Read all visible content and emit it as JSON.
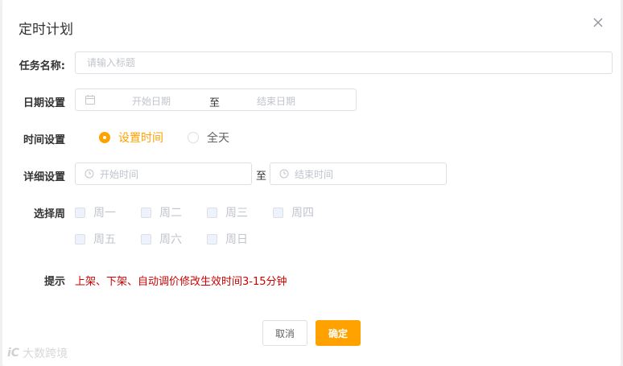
{
  "dialog": {
    "title": "定时计划",
    "close_icon": "close-icon"
  },
  "form": {
    "task_name": {
      "label": "任务名称:",
      "placeholder": "请输入标题",
      "value": ""
    },
    "date": {
      "label": "日期设置",
      "start_placeholder": "开始日期",
      "separator": "至",
      "end_placeholder": "结束日期",
      "icon": "calendar-icon"
    },
    "time_mode": {
      "label": "时间设置",
      "options": [
        {
          "label": "设置时间",
          "selected": true
        },
        {
          "label": "全天",
          "selected": false
        }
      ]
    },
    "detail_time": {
      "label": "详细设置",
      "start_placeholder": "开始时间",
      "separator": "至",
      "end_placeholder": "结束时间",
      "icon": "clock-icon"
    },
    "weekdays": {
      "label": "选择周",
      "days": [
        "周一",
        "周二",
        "周三",
        "周四",
        "周五",
        "周六",
        "周日"
      ]
    },
    "tip": {
      "label": "提示",
      "text": "上架、下架、自动调价修改生效时间3-15分钟"
    }
  },
  "buttons": {
    "cancel": "取消",
    "confirm": "确定"
  },
  "watermark": {
    "logo": "iC",
    "text": "大数跨境"
  },
  "colors": {
    "accent": "#ffa200",
    "tip": "#d00000",
    "border": "#dcdfe6",
    "placeholder": "#c0c4cc"
  }
}
